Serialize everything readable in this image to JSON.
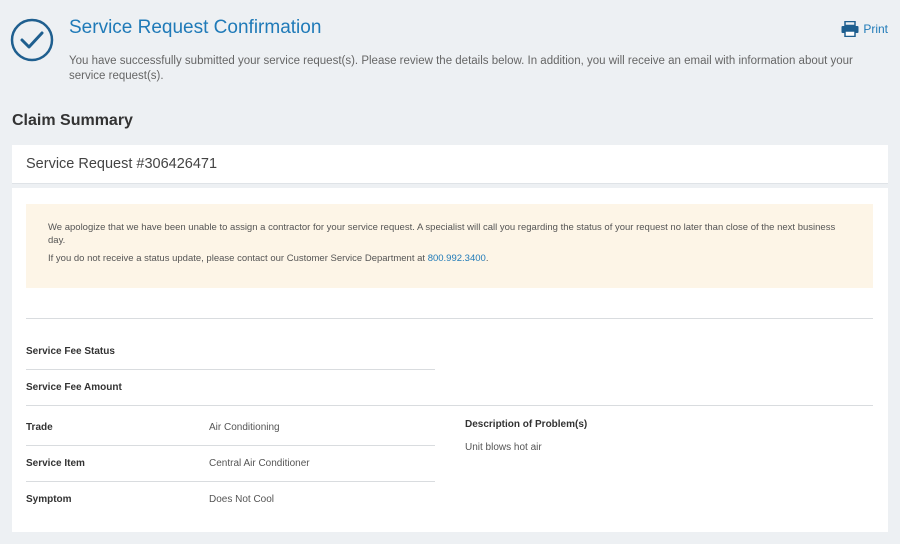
{
  "header": {
    "title": "Service Request Confirmation",
    "subtitle": "You have successfully submitted your service request(s).  Please review the details below.  In addition, you will receive an email with information about your service request(s).",
    "print_label": "Print"
  },
  "summary": {
    "section_title": "Claim Summary",
    "request_title": "Service Request #306426471"
  },
  "notice": {
    "line1": "We apologize that we have been unable to assign a contractor for your service request. A specialist will call you regarding the status of your request no later than close of the next business day.",
    "line2_prefix": "If you do not receive a status update, please contact our Customer Service Department at ",
    "phone": "800.992.3400",
    "line2_suffix": "."
  },
  "details": {
    "service_fee_status_label": "Service Fee Status",
    "service_fee_status_value": "",
    "service_fee_amount_label": "Service Fee Amount",
    "service_fee_amount_value": "",
    "trade_label": "Trade",
    "trade_value": "Air Conditioning",
    "service_item_label": "Service Item",
    "service_item_value": "Central Air Conditioner",
    "symptom_label": "Symptom",
    "symptom_value": "Does Not Cool",
    "description_label": "Description of Problem(s)",
    "description_value": "Unit blows hot air"
  },
  "colors": {
    "accent": "#1f7ab8",
    "background": "#edf0f3",
    "notice_bg": "#fdf5e7"
  }
}
